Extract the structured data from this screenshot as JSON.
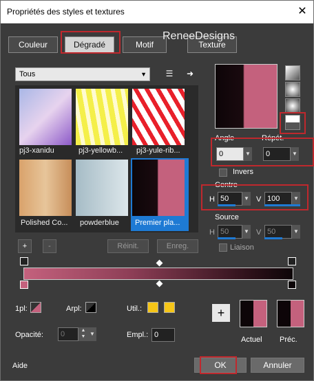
{
  "window": {
    "title": "Propriétés des styles et textures",
    "close": "✕"
  },
  "tabs": [
    {
      "label": "Couleur"
    },
    {
      "label": "Dégradé"
    },
    {
      "label": "Motif"
    },
    {
      "label": "Texture"
    }
  ],
  "watermark": "ReneeDesigns",
  "category": {
    "value": "Tous"
  },
  "gradients": [
    {
      "name": "pj3-xanidu"
    },
    {
      "name": "pj3-yellowb..."
    },
    {
      "name": "pj3-yule-rib..."
    },
    {
      "name": "Polished Co..."
    },
    {
      "name": "powderblue"
    },
    {
      "name": "Premier pla..."
    }
  ],
  "editor_buttons": {
    "add": "+",
    "remove": "-",
    "reset": "Réinit.",
    "save": "Enreg."
  },
  "angle": {
    "label": "Angle",
    "value": "0"
  },
  "repeat": {
    "label": "Répét.",
    "value": "0"
  },
  "invert": {
    "label": "Invers"
  },
  "center": {
    "label": "Centre",
    "h_label": "H",
    "h_value": "50",
    "v_label": "V",
    "v_value": "100"
  },
  "source": {
    "label": "Source",
    "h_label": "H",
    "h_value": "50",
    "v_label": "V",
    "v_value": "50"
  },
  "link": {
    "label": "Liaison"
  },
  "stop_props": {
    "first_label": "1pl:",
    "arpl_label": "Arpl:",
    "util_label": "Util.:",
    "opacity_label": "Opacité:",
    "opacity_value": "0",
    "empl_label": "Empl.:",
    "empl_value": "0"
  },
  "compare": {
    "plus": "+",
    "current": "Actuel",
    "previous": "Préc."
  },
  "footer": {
    "help": "Aide",
    "ok": "OK",
    "cancel": "Annuler"
  },
  "colors": {
    "pink": "#c4617d",
    "dark": "#0d0508",
    "accent": "#1e7ad4",
    "highlight": "#c0282d",
    "util": "#f5c518"
  }
}
